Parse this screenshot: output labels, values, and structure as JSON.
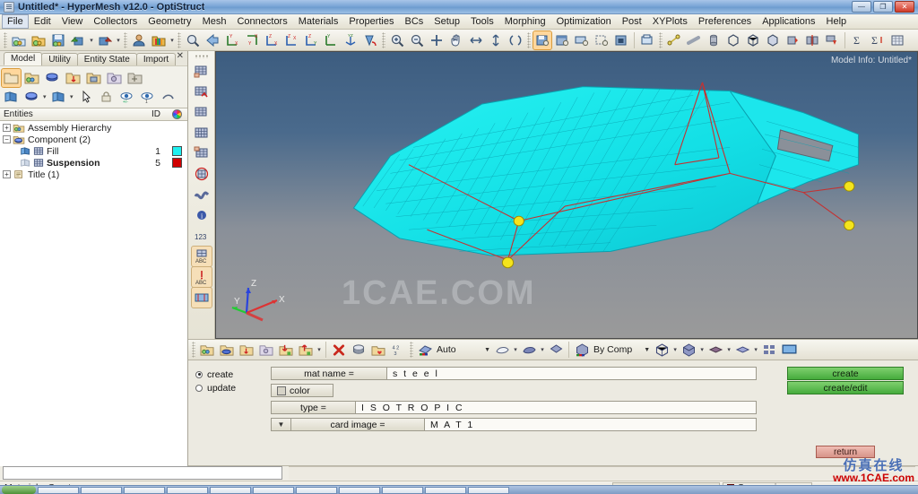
{
  "window": {
    "title": "Untitled* - HyperMesh v12.0 - OptiStruct",
    "minimize_label": "—",
    "restore_label": "❐",
    "close_label": "✕"
  },
  "menubar": {
    "items": [
      {
        "label": "File"
      },
      {
        "label": "Edit"
      },
      {
        "label": "View"
      },
      {
        "label": "Collectors"
      },
      {
        "label": "Geometry"
      },
      {
        "label": "Mesh"
      },
      {
        "label": "Connectors"
      },
      {
        "label": "Materials"
      },
      {
        "label": "Properties"
      },
      {
        "label": "BCs"
      },
      {
        "label": "Setup"
      },
      {
        "label": "Tools"
      },
      {
        "label": "Morphing"
      },
      {
        "label": "Optimization"
      },
      {
        "label": "Post"
      },
      {
        "label": "XYPlots"
      },
      {
        "label": "Preferences"
      },
      {
        "label": "Applications"
      },
      {
        "label": "Help"
      }
    ]
  },
  "toolbar": {
    "groups": [
      {
        "icons": [
          "open-model-icon",
          "open-folder-icon",
          "save-model-icon",
          "import-icon",
          "export-icon"
        ]
      },
      {
        "icons": [
          "user-profile-icon",
          "color-palette-icon"
        ]
      },
      {
        "icons": [
          "zoom-window-icon",
          "back-arrow-icon",
          "view-xy-icon",
          "view-yx-icon",
          "view-zx-icon",
          "view-xz-icon",
          "view-zy-icon",
          "view-yz-icon",
          "view-iso-icon",
          "view-rotate-icon"
        ]
      },
      {
        "icons": [
          "zoom-in-icon",
          "zoom-out-icon",
          "fit-view-icon",
          "pan-hand-icon",
          "arrow-left-right-icon",
          "arrow-up-down-icon",
          "rotate-icon"
        ]
      },
      {
        "icons": [
          "save-capture-icon",
          "capture-window-icon",
          "capture-screen-icon",
          "capture-region-icon",
          "capture-video-icon",
          "capture-print-icon"
        ]
      },
      {
        "icons": [
          "node-edit-icon",
          "line-icon",
          "solid-cylinder-icon",
          "wireframe-cube-icon",
          "shaded-cube-icon",
          "transparent-cube-icon",
          "mesh-red-icon",
          "mesh-blue-icon",
          "mesh-arrow-icon"
        ]
      },
      {
        "icons": [
          "summation-icon",
          "summation-sort-icon",
          "table-icon"
        ]
      }
    ]
  },
  "browser": {
    "tabs": [
      {
        "label": "Model",
        "selected": true
      },
      {
        "label": "Utility",
        "selected": false
      },
      {
        "label": "Entity State",
        "selected": false
      },
      {
        "label": "Import",
        "selected": false
      }
    ],
    "close_label": "✕",
    "tool_row_1": [
      "folder-blank-icon",
      "assembly-icon",
      "component-icon",
      "load-collector-icon",
      "system-collector-icon",
      "vector-collector-icon",
      "group-collector-icon"
    ],
    "tool_row_2": [
      "geometry-icon",
      "component-shade-icon",
      "component-mesh-icon",
      "pointer-icon",
      "lock-icon",
      "show-hide-icon",
      "isolate-icon",
      "reverse-icon"
    ],
    "header": {
      "entities": "Entities",
      "id": "ID",
      "color": "color-wheel-icon"
    },
    "tree": [
      {
        "label": "Assembly Hierarchy",
        "id": "",
        "color": "",
        "indent": 0,
        "expander": "+",
        "icon": "assembly-icon",
        "bold": false
      },
      {
        "label": "Component (2)",
        "id": "",
        "color": "",
        "indent": 0,
        "expander": "-",
        "icon": "component-folder-icon",
        "bold": false
      },
      {
        "label": "Fill",
        "id": "1",
        "color": "#20f0f0",
        "indent": 1,
        "expander": "",
        "icon": "component-mesh-icon",
        "bold": false
      },
      {
        "label": "Suspension",
        "id": "5",
        "color": "#d10000",
        "indent": 1,
        "expander": "",
        "icon": "component-mesh-icon",
        "bold": true
      },
      {
        "label": "Title (1)",
        "id": "",
        "color": "",
        "indent": 0,
        "expander": "+",
        "icon": "title-icon",
        "bold": false
      }
    ]
  },
  "viewport": {
    "model_info": "Model Info: Untitled*",
    "watermark": "1CAE.COM",
    "axis": {
      "x": "X",
      "y": "Y",
      "z": "Z"
    },
    "left_toolbar": [
      "mesh-edit-icon",
      "mesh-check-icon",
      "mesh-split-icon",
      "mesh-grid-icon",
      "mesh-window-icon",
      "mesh-circle-icon",
      "mesh-ribbon-icon",
      "info-icon",
      "count-123-icon",
      "abc-label-icon",
      "abc-number-icon",
      "shrink-icon"
    ],
    "colors": {
      "mesh_fill": "#19e8e8",
      "mesh_edge": "#0fa8b4",
      "suspension_line": "#c03030",
      "node_marker": "#f2e21c"
    }
  },
  "panel_toolbar": {
    "icons_left": [
      "collector-icon",
      "component-icon",
      "load-collector-icon",
      "system-icon",
      "import-down-icon",
      "export-up-icon"
    ],
    "icons_mid": [
      "delete-red-x-icon",
      "copy-stack-icon",
      "folder-heart-icon",
      "renumber-123-icon"
    ],
    "mesh_mode": {
      "icon": "mesh-mode-icon",
      "value": "Auto",
      "caret": "▼"
    },
    "shape_dropdowns": [
      "curve-shade-icon",
      "surface-shade-icon",
      "solid-shade-icon",
      "wire-cube-icon"
    ],
    "color_mode": {
      "icon": "by-comp-icon",
      "value": "By Comp",
      "caret": "▼"
    },
    "view_dropdowns": [
      "wireframe-icon",
      "shaded-cube-icon",
      "shaded-face-icon",
      "shaded-plate-icon"
    ],
    "extra_icons": [
      "tile-windows-icon",
      "monitor-icon"
    ]
  },
  "command_panel": {
    "mode": {
      "create_label": "create",
      "update_label": "update",
      "selected": "create"
    },
    "fields": [
      {
        "label": "mat name =",
        "value": "s t e e l"
      },
      {
        "label": "color",
        "value": ""
      },
      {
        "label": "type =",
        "value": "I S O T R O P I C"
      },
      {
        "label": "card image =",
        "value": "M A T 1"
      }
    ],
    "buttons": {
      "create": "create",
      "create_edit": "create/edit",
      "return": "return"
    },
    "caret": "▼"
  },
  "status": {
    "message": "Materials: Create",
    "command_value": "",
    "current_component": "Suspension",
    "current_component_color": "#d10000"
  },
  "watermark": {
    "chinese": "仿真在线",
    "url": "www.1CAE.com"
  }
}
